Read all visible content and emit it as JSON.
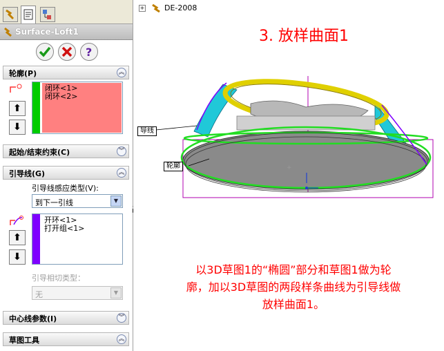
{
  "tree": {
    "root_label": "DE-2008"
  },
  "feature": {
    "title": "Surface-Loft1"
  },
  "sections": {
    "profile": {
      "label": "轮廓(P)",
      "items": [
        "闭环<1>",
        "闭环<2>"
      ]
    },
    "constraints": {
      "label": "起始/结束约束(C)"
    },
    "guides": {
      "label": "引导线(G)",
      "influence_label": "引导线感应类型(V):",
      "influence_value": "到下一引线",
      "items": [
        "开环<1>",
        "打开组<1>"
      ],
      "tangency_label": "引导相切类型：",
      "tangency_value": "无"
    },
    "centerline": {
      "label": "中心线参数(I)"
    },
    "sketch_tools": {
      "label": "草图工具"
    }
  },
  "viewport": {
    "heading": "3. 放样曲面1",
    "callout_guide": "导线",
    "callout_profile": "轮廓",
    "description_lines": [
      "以3D草图1的“椭圆”部分和草图1做为轮",
      "廓，加以3D草图的两段样条曲线为引导线做",
      "放样曲面1。"
    ]
  },
  "colors": {
    "accent_red": "#ff0000",
    "profile_fill": "#ff8080",
    "profile_bar": "#00cc00",
    "guide_bar": "#7f00ff",
    "loft_cyan": "#20c8d8",
    "loft_yellow": "#e8d800",
    "ellipse_green": "#22dd22"
  },
  "icons": [
    "feature-manager-tab-icon",
    "property-manager-tab-icon",
    "configuration-tab-icon",
    "ok-check-icon",
    "cancel-x-icon",
    "help-question-icon",
    "profile-icon",
    "guide-icon",
    "move-up-icon",
    "move-down-icon"
  ]
}
